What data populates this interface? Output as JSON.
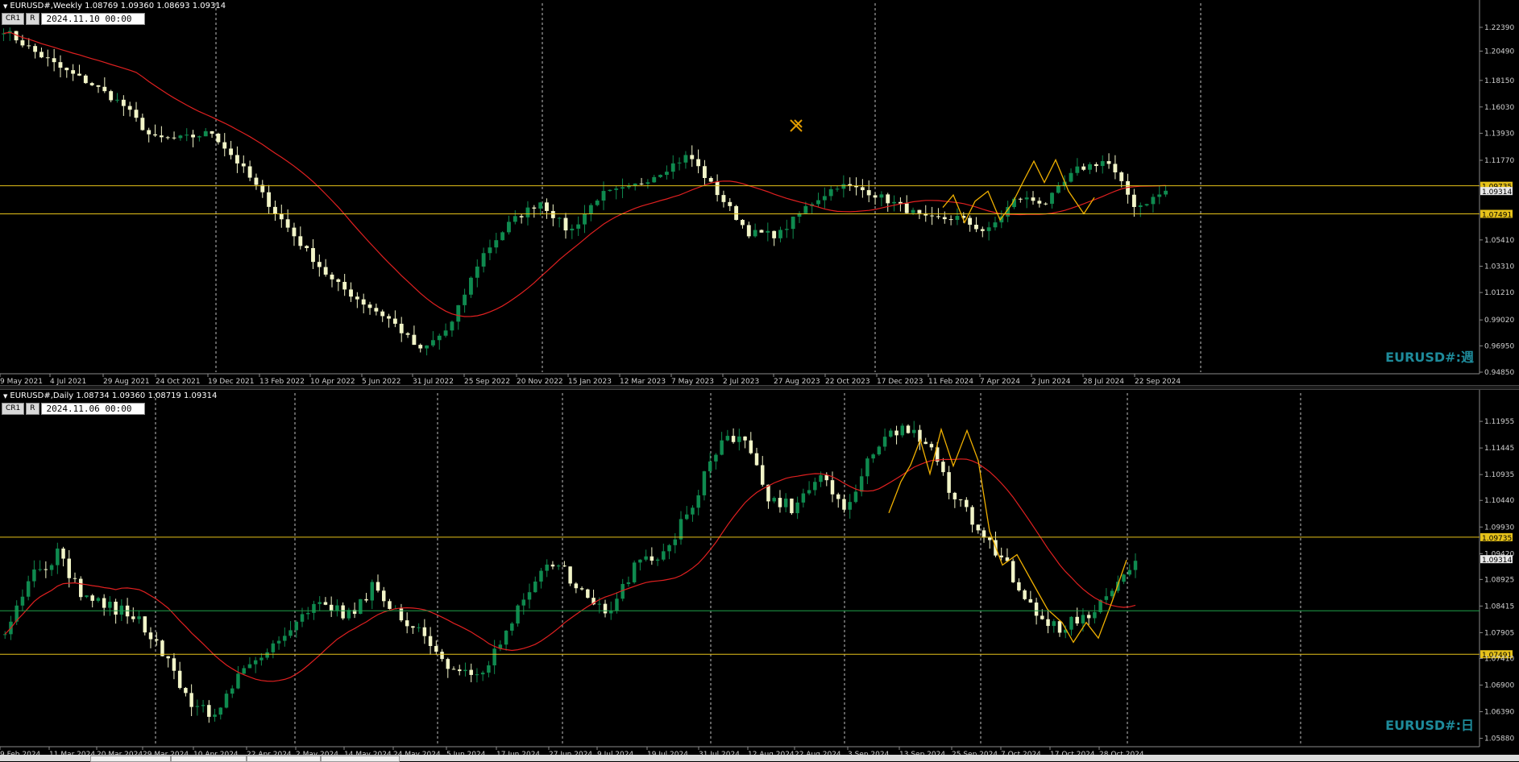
{
  "weekly": {
    "header": "EURUSD#,Weekly  1.08769 1.09360 1.08693 1.09314",
    "tag1": "CR1",
    "tag2": "R",
    "cursor_date": "2024.11.10 00:00",
    "symbol_label": "EURUSD#:週",
    "price_labels": [
      "1.22390",
      "1.20490",
      "1.18150",
      "1.16030",
      "1.13930",
      "1.11770",
      "1.09735",
      "1.09314",
      "1.07491",
      "1.05410",
      "1.03310",
      "1.01210",
      "0.99020",
      "0.96950",
      "0.94850"
    ],
    "hline_labels": [
      "1.09735",
      "1.07491"
    ],
    "date_labels": [
      "9 May 2021",
      "4 Jul 2021",
      "29 Aug 2021",
      "24 Oct 2021",
      "19 Dec 2021",
      "13 Feb 2022",
      "10 Apr 2022",
      "5 Jun 2022",
      "31 Jul 2022",
      "25 Sep 2022",
      "20 Nov 2022",
      "15 Jan 2023",
      "12 Mar 2023",
      "7 May 2023",
      "2 Jul 2023",
      "27 Aug 2023",
      "22 Oct 2023",
      "17 Dec 2023",
      "11 Feb 2024",
      "7 Apr 2024",
      "2 Jun 2024",
      "28 Jul 2024",
      "22 Sep 2024"
    ]
  },
  "daily": {
    "header": "EURUSD#,Daily  1.08734 1.09360 1.08719 1.09314",
    "tag1": "CR1",
    "tag2": "R",
    "cursor_date": "2024.11.06 00:00",
    "symbol_label": "EURUSD#:日",
    "price_labels": [
      "1.11955",
      "1.11445",
      "1.10935",
      "1.10440",
      "1.09930",
      "1.09735",
      "1.09420",
      "1.09314",
      "1.08925",
      "1.08415",
      "1.07905",
      "1.07491",
      "1.07410",
      "1.06900",
      "1.06390",
      "1.05880"
    ],
    "hline_labels": [
      "1.09735",
      "1.08325",
      "1.07491"
    ],
    "date_labels": [
      "9 Feb 2024",
      "11 Mar 2024",
      "20 Mar 2024",
      "29 Mar 2024",
      "10 Apr 2024",
      "22 Apr 2024",
      "2 May 2024",
      "14 May 2024",
      "24 May 2024",
      "5 Jun 2024",
      "17 Jun 2024",
      "27 Jun 2024",
      "9 Jul 2024",
      "19 Jul 2024",
      "31 Jul 2024",
      "12 Aug 2024",
      "22 Aug 2024",
      "3 Sep 2024",
      "13 Sep 2024",
      "25 Sep 2024",
      "7 Oct 2024",
      "17 Oct 2024",
      "28 Oct 2024"
    ]
  },
  "colors": {
    "bull": "#0f8a4f",
    "bear": "#f2f5c8",
    "ma": "#e02020",
    "hline": "#e6c21a",
    "wave": "#f0b000",
    "midline": "#1fa04a",
    "label_bg": "#e6c21a",
    "grid": "#ffffff"
  }
}
